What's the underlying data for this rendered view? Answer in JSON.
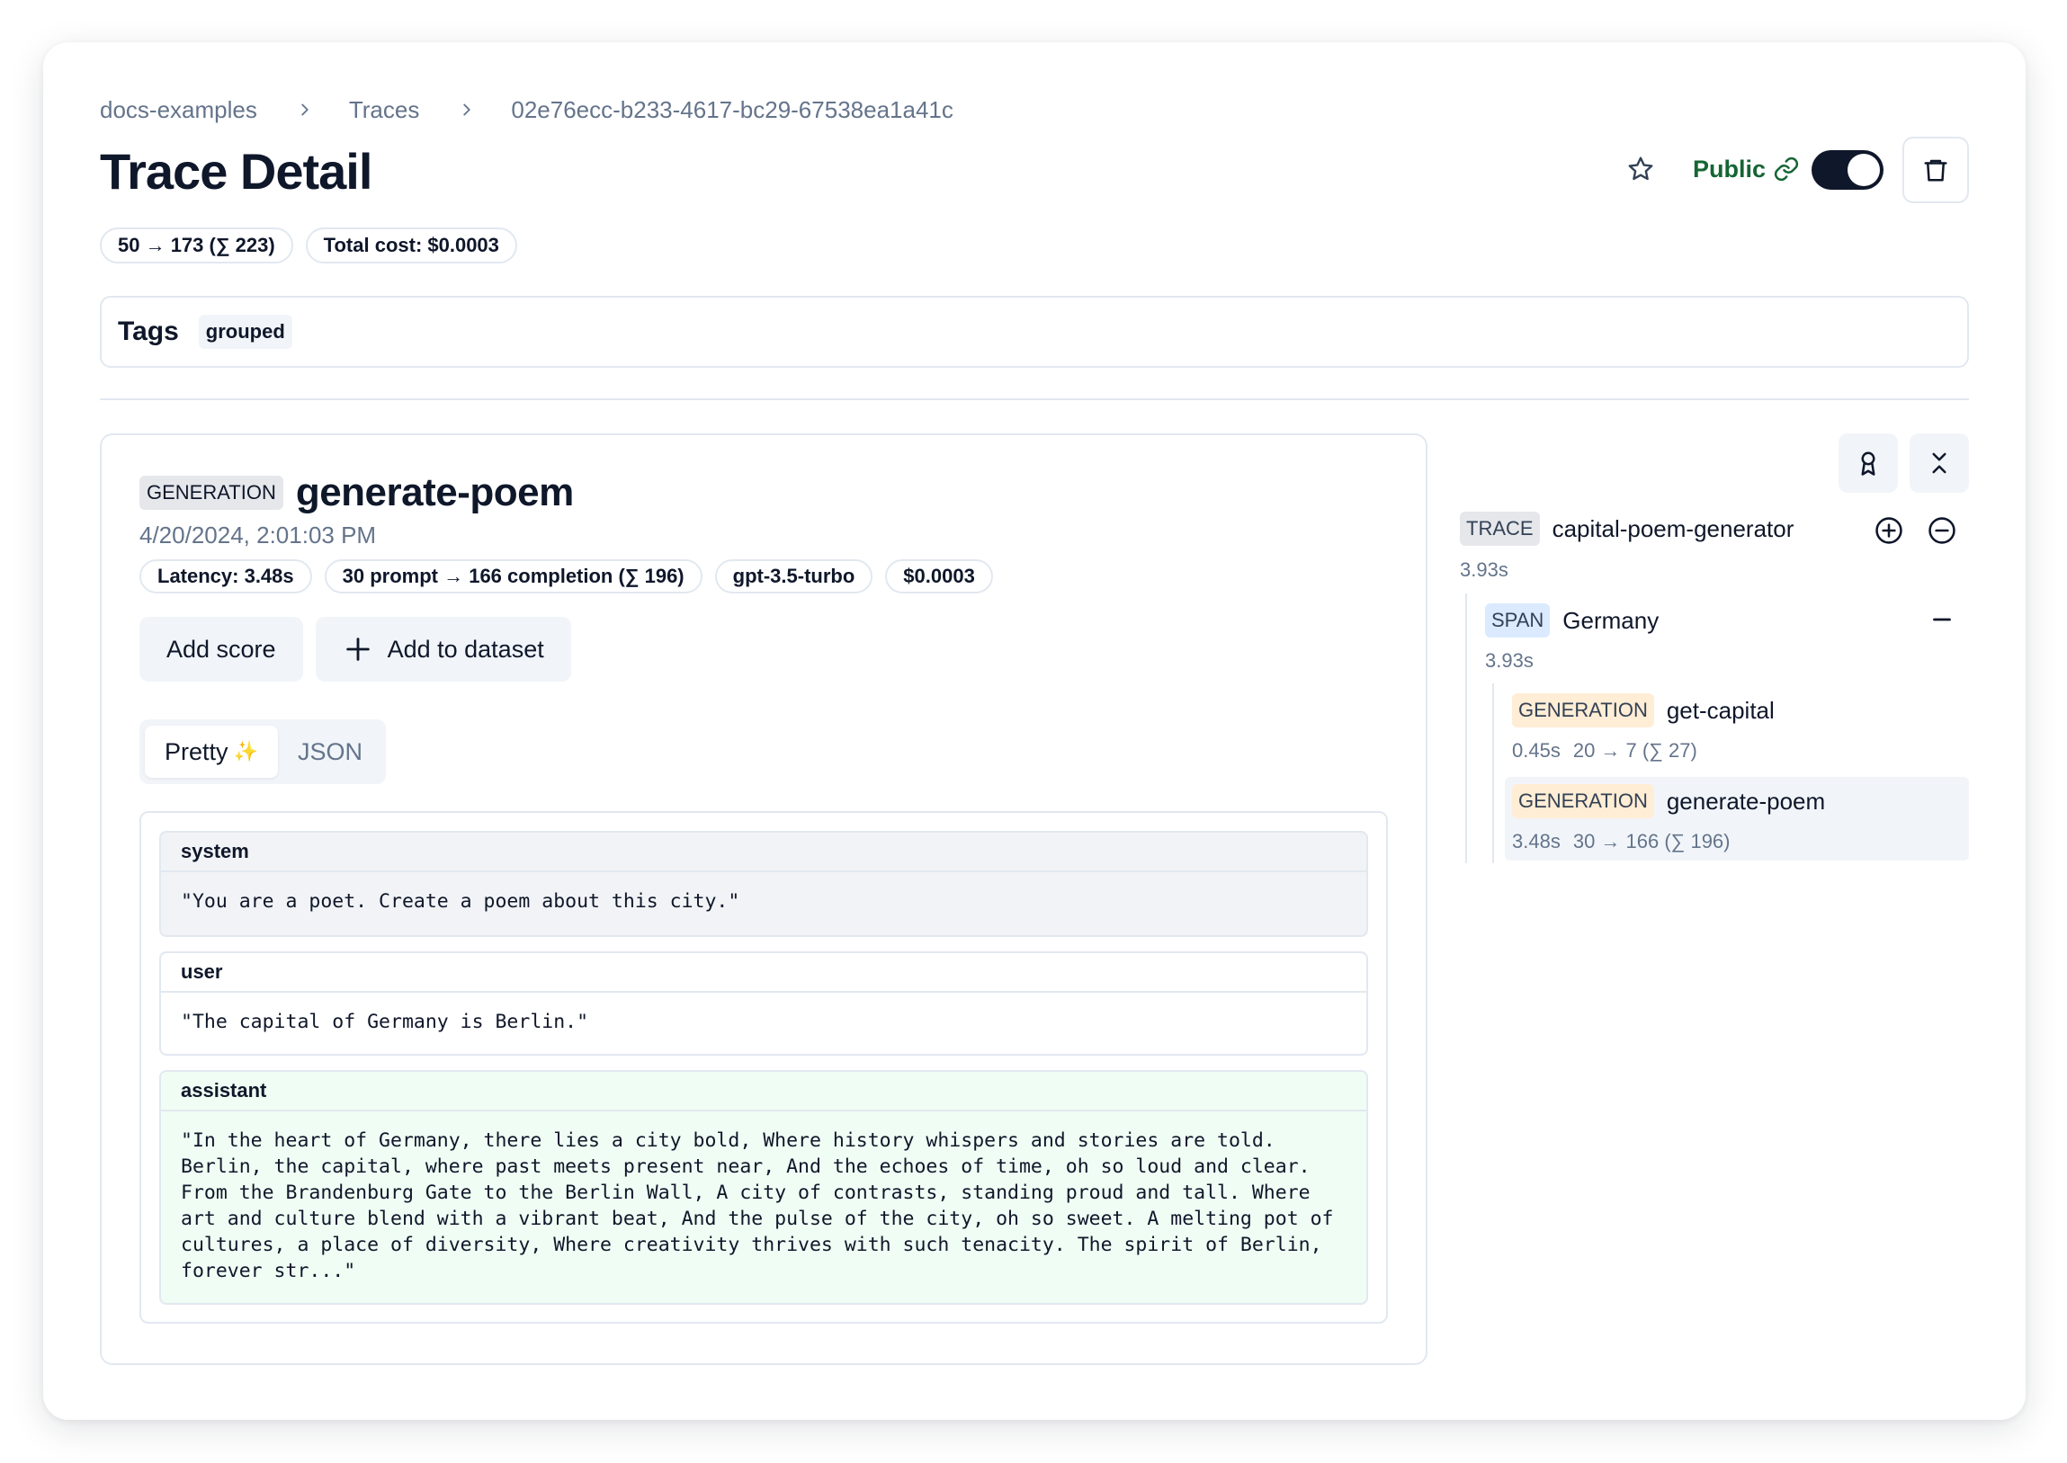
{
  "breadcrumb": {
    "project": "docs-examples",
    "section": "Traces",
    "trace_id": "02e76ecc-b233-4617-bc29-67538ea1a41c"
  },
  "page": {
    "title": "Trace Detail",
    "public_label": "Public",
    "public_enabled": true,
    "usage_badge": "50 → 173 (∑ 223)",
    "cost_badge": "Total cost: $0.0003"
  },
  "tags": {
    "label": "Tags",
    "items": [
      "grouped"
    ]
  },
  "observation": {
    "type": "GENERATION",
    "name": "generate-poem",
    "timestamp": "4/20/2024, 2:01:03 PM",
    "badges": {
      "latency": "Latency: 3.48s",
      "tokens": "30 prompt → 166 completion (∑ 196)",
      "model": "gpt-3.5-turbo",
      "cost": "$0.0003"
    },
    "buttons": {
      "add_score": "Add score",
      "add_to_dataset": "Add to dataset"
    },
    "view_tabs": {
      "pretty": "Pretty",
      "pretty_emoji": "✨",
      "json": "JSON",
      "active": "pretty"
    },
    "messages": [
      {
        "role": "system",
        "content": "\"You are a poet. Create a poem about this city.\""
      },
      {
        "role": "user",
        "content": "\"The capital of Germany is Berlin.\""
      },
      {
        "role": "assistant",
        "content": "\"In the heart of Germany, there lies a city bold, Where history whispers and stories are told. Berlin, the capital, where past meets present near, And the echoes of time, oh so loud and clear. From the Brandenburg Gate to the Berlin Wall, A city of contrasts, standing proud and tall. Where art and culture blend with a vibrant beat, And the pulse of the city, oh so sweet. A melting pot of cultures, a place of diversity, Where creativity thrives with such tenacity. The spirit of Berlin, forever str...\""
      }
    ]
  },
  "tree": {
    "trace": {
      "type": "TRACE",
      "name": "capital-poem-generator",
      "latency": "3.93s"
    },
    "span": {
      "type": "SPAN",
      "name": "Germany",
      "latency": "3.93s"
    },
    "generations": [
      {
        "type": "GENERATION",
        "name": "get-capital",
        "latency": "0.45s",
        "tokens": "20 → 7 (∑ 27)",
        "selected": false
      },
      {
        "type": "GENERATION",
        "name": "generate-poem",
        "latency": "3.48s",
        "tokens": "30 → 166 (∑ 196)",
        "selected": true
      }
    ]
  },
  "colors": {
    "public_green": "#166534",
    "toggle_on": "#0f172a",
    "assistant_bg": "#f0fdf4",
    "system_bg": "#f1f3f6",
    "span_badge": "#dbeafe",
    "generation_badge": "#ffedd5",
    "sparkle": "#facc15"
  }
}
